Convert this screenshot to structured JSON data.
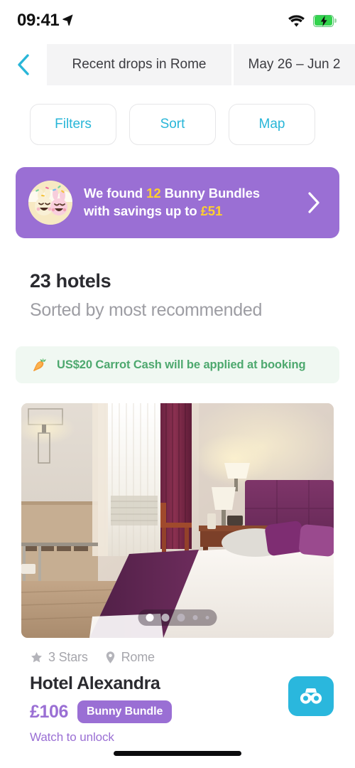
{
  "status_bar": {
    "time": "09:41",
    "location_icon": "location-arrow-icon",
    "wifi_icon": "wifi-icon",
    "battery_icon": "battery-charging-icon"
  },
  "header": {
    "back_icon": "chevron-left-icon",
    "location_label": "Recent drops in Rome",
    "dates_label": "May 26 – Jun 2"
  },
  "filters": {
    "items": [
      {
        "label": "Filters",
        "name": "filters-button"
      },
      {
        "label": "Sort",
        "name": "sort-button"
      },
      {
        "label": "Map",
        "name": "map-button"
      }
    ]
  },
  "promo": {
    "icon": "bunny-bundle-icon",
    "line1_prefix": "We found ",
    "count": "12",
    "line1_suffix": " Bunny Bundles",
    "line2_prefix": "with savings up to ",
    "savings": "£51",
    "chevron_icon": "chevron-right-icon",
    "background_color": "#9a6fd4",
    "highlight_color": "#ffcf2e"
  },
  "results": {
    "count_label": "23 hotels",
    "sort_label": "Sorted by most recommended"
  },
  "carrot_banner": {
    "icon": "carrot-icon",
    "text": "US$20 Carrot Cash will be applied at booking",
    "text_color": "#4da86e",
    "background_color": "#f0f8f2"
  },
  "hotel_card": {
    "photo_alt": "hotel-room-photo",
    "carousel": {
      "total": 5,
      "active_index": 0
    },
    "stars_icon": "star-icon",
    "stars_label": "3 Stars",
    "location_icon": "map-pin-icon",
    "location_label": "Rome",
    "name": "Hotel Alexandra",
    "price": "£106",
    "price_color": "#9a6fd4",
    "badge_label": "Bunny Bundle",
    "watch_label": "Watch to unlock",
    "watch_button_icon": "binoculars-icon",
    "watch_button_color": "#2ab7dd"
  },
  "home_indicator": "home-indicator"
}
